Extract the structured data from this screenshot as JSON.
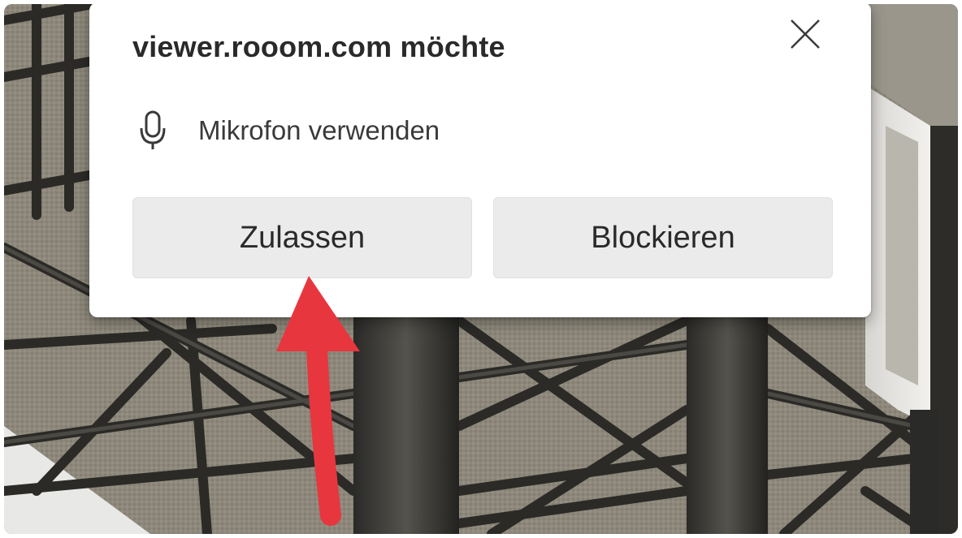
{
  "dialog": {
    "title": "viewer.rooom.com möchte",
    "permission": {
      "icon": "microphone-icon",
      "label": "Mikrofon verwenden"
    },
    "buttons": {
      "allow_label": "Zulassen",
      "block_label": "Blockieren"
    },
    "close_icon": "close-icon"
  },
  "annotation": {
    "arrow_color": "#e8363f"
  },
  "background": {
    "description_icon": "steel-truss-3d-scene"
  }
}
